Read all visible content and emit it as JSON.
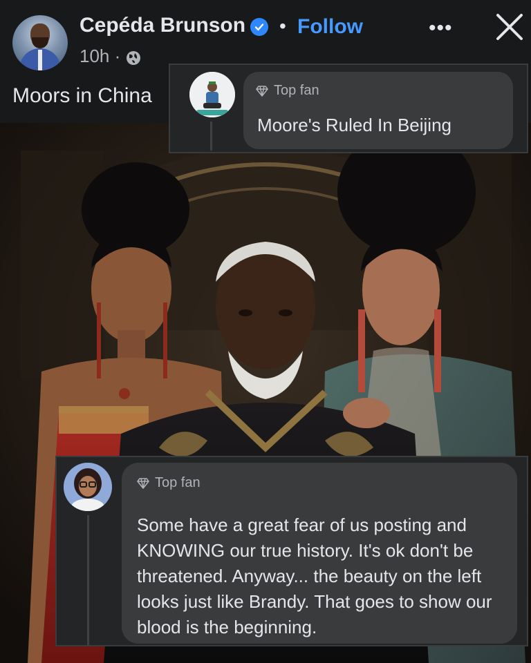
{
  "post": {
    "author": "Cepéda Brunson",
    "separator": "•",
    "follow_label": "Follow",
    "more_label": "•••",
    "time": "10h ·",
    "caption": "Moors in China"
  },
  "comments": [
    {
      "badge": "Top fan",
      "text": "Moore's Ruled In Beijing"
    },
    {
      "badge": "Top fan",
      "text": "Some have a great fear of us posting and KNOWING our true history. It's ok don't be threatened. Anyway... the beauty on the left looks just like Brandy. That goes to show our blood is the beginning."
    }
  ],
  "colors": {
    "background": "#18191a",
    "bubble": "#3a3b3c",
    "link": "#4599ff",
    "verified": "#2d88ff",
    "muted_text": "#b0b3b8"
  },
  "icons": [
    "verified-badge-icon",
    "more-options-icon",
    "close-icon",
    "globe-icon",
    "diamond-icon"
  ]
}
